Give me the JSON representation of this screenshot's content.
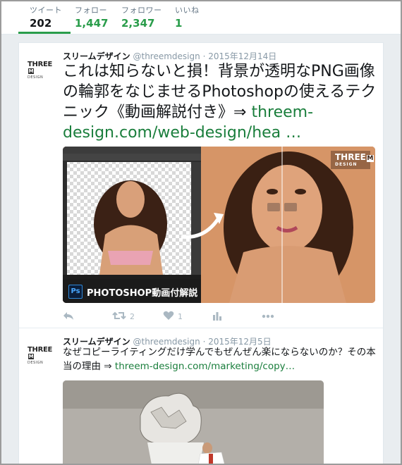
{
  "stats": [
    {
      "label": "ツイート",
      "value": "202"
    },
    {
      "label": "フォロー",
      "value": "1,447"
    },
    {
      "label": "フォロワー",
      "value": "2,347"
    },
    {
      "label": "いいね",
      "value": "1"
    }
  ],
  "tweets": [
    {
      "logo_text": "THREE",
      "logo_sub": "DESIGN",
      "name": "スリームデザイン",
      "handle": "@threemdesign",
      "date": "2015年12月14日",
      "text": "これは知らないと損！背景が透明なPNG画像の輪郭をなじませるPhotoshopの使えるテクニック《動画解説付き》⇒ ",
      "link": "threem-design.com/web-design/hea …",
      "media_caption": "PHOTOSHOP動画付解説",
      "media_badge": "Ps",
      "media_logo": "THREE",
      "media_logo_sub": "DESIGN",
      "retweets": "2",
      "likes": "1"
    },
    {
      "logo_text": "THREE",
      "logo_sub": "DESIGN",
      "name": "スリームデザイン",
      "handle": "@threemdesign",
      "date": "2015年12月5日",
      "text": "なぜコピーライティングだけ学んでもぜんぜん楽にならないのか？その本当の理由 ⇒ ",
      "link": "threem-design.com/marketing/copy…"
    }
  ]
}
